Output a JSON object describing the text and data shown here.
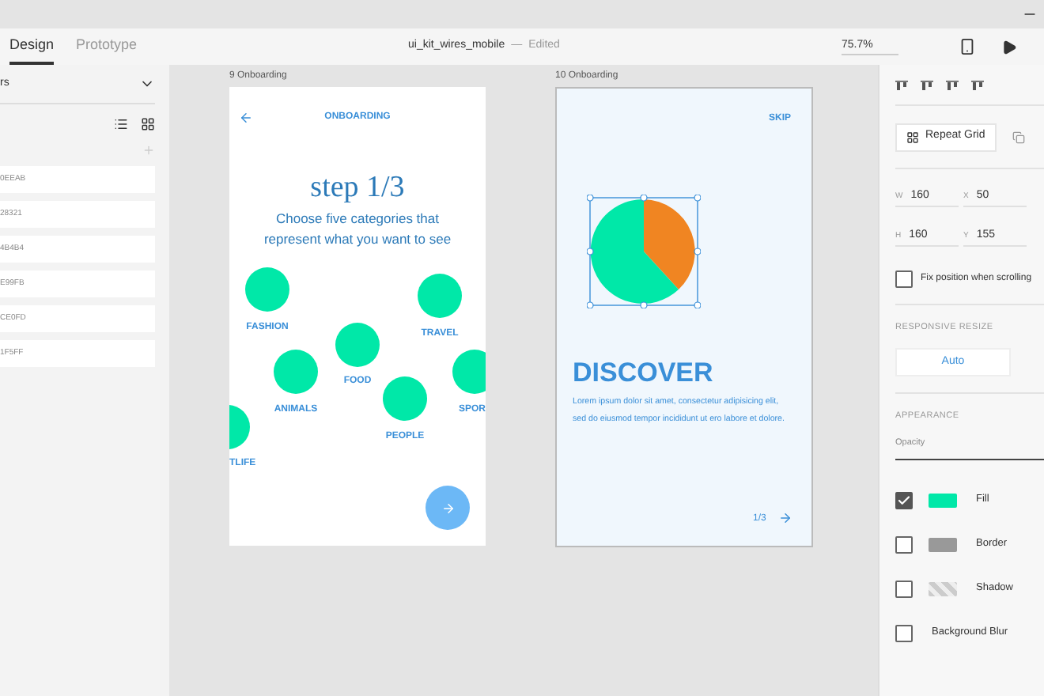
{
  "toolbar": {
    "tabs": [
      {
        "label": "Design",
        "selected": true
      },
      {
        "label": "Prototype",
        "selected": false
      }
    ],
    "document_title": "ui_kit_wires_mobile",
    "separator": "—",
    "document_status": "Edited",
    "zoom": "75.7%"
  },
  "assets_panel": {
    "section": "rs",
    "swatches": [
      {
        "code": "0EEAB"
      },
      {
        "code": "28321"
      },
      {
        "code": "4B4B4"
      },
      {
        "code": "E99FB"
      },
      {
        "code": "CE0FD"
      },
      {
        "code": "1F5FF"
      }
    ]
  },
  "artboards": [
    {
      "name": "9 Onboarding",
      "header": "ONBOARDING",
      "title": "step 1/3",
      "subtitle": "Choose five categories that represent what you want to see",
      "categories": [
        {
          "label": "FASHION"
        },
        {
          "label": "TRAVEL"
        },
        {
          "label": "FOOD"
        },
        {
          "label": "ANIMALS"
        },
        {
          "label": "SPOR"
        },
        {
          "label": "PEOPLE"
        },
        {
          "label": "TLIFE"
        }
      ]
    },
    {
      "name": "10 Onboarding",
      "skip": "SKIP",
      "heading": "DISCOVER",
      "body": "Lorem ipsum dolor sit amet, consectetur adipisicing elit, sed do eiusmod tempor incididunt ut ero labore et dolore.",
      "pager": "1/3"
    }
  ],
  "inspector": {
    "repeat_grid": "Repeat Grid",
    "fields": [
      {
        "label": "W",
        "value": "160"
      },
      {
        "label": "X",
        "value": "50"
      },
      {
        "label": "H",
        "value": "160"
      },
      {
        "label": "Y",
        "value": "155"
      }
    ],
    "fix_position": {
      "label": "Fix position when scrolling",
      "checked": false
    },
    "responsive_resize": {
      "title": "RESPONSIVE RESIZE",
      "options": [
        {
          "label": "Auto",
          "selected": true
        }
      ]
    },
    "appearance": {
      "title": "APPEARANCE",
      "opacity_label": "Opacity",
      "properties": [
        {
          "label": "Fill",
          "checked": true,
          "kind": "fill"
        },
        {
          "label": "Border",
          "checked": false,
          "kind": "border"
        },
        {
          "label": "Shadow",
          "checked": false,
          "kind": "shadow"
        },
        {
          "label": "Background Blur",
          "checked": false,
          "kind": "blur"
        }
      ]
    }
  }
}
